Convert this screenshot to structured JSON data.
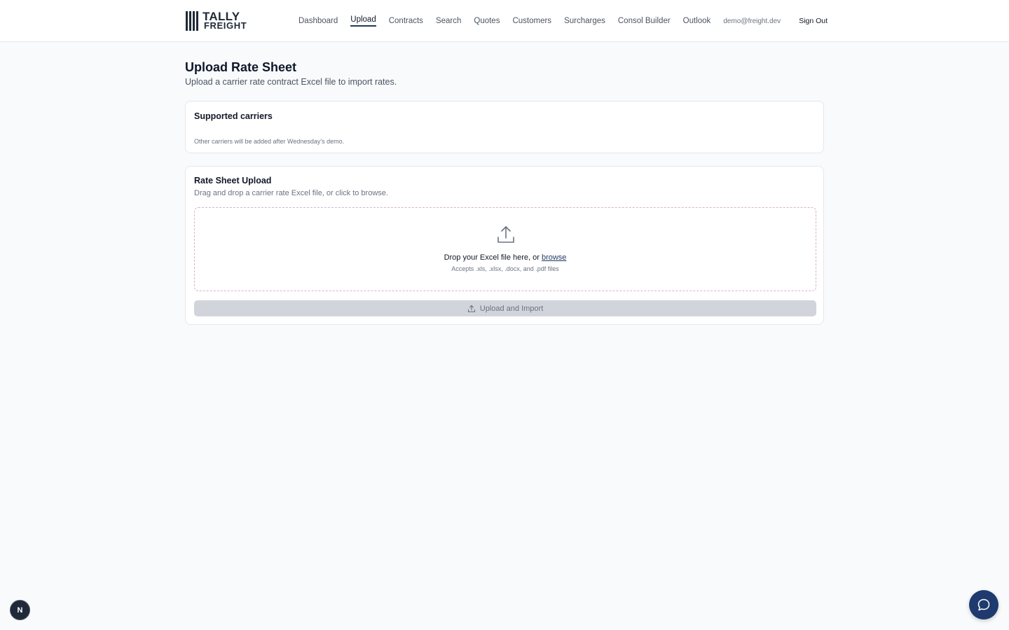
{
  "brand": {
    "line1": "TALLY",
    "line2": "FREIGHT"
  },
  "nav": {
    "items": [
      {
        "label": "Dashboard",
        "active": false
      },
      {
        "label": "Upload",
        "active": true
      },
      {
        "label": "Contracts",
        "active": false
      },
      {
        "label": "Search",
        "active": false
      },
      {
        "label": "Quotes",
        "active": false
      },
      {
        "label": "Customers",
        "active": false
      },
      {
        "label": "Surcharges",
        "active": false
      },
      {
        "label": "Consol Builder",
        "active": false
      },
      {
        "label": "Outlook",
        "active": false
      }
    ],
    "email": "demo@freight.dev",
    "sign_out": "Sign Out"
  },
  "page": {
    "title": "Upload Rate Sheet",
    "subtitle": "Upload a carrier rate contract Excel file to import rates."
  },
  "carriers_card": {
    "title": "Supported carriers",
    "note": "Other carriers will be added after Wednesday's demo."
  },
  "upload_card": {
    "title": "Rate Sheet Upload",
    "description": "Drag and drop a carrier rate Excel file, or click to browse.",
    "drop_text": "Drop your Excel file here, or",
    "browse_label": "browse",
    "accepts": "Accepts .xls, .xlsx, .docx, and .pdf files",
    "button_label": "Upload and Import",
    "button_icon": "upload-icon"
  },
  "badge": {
    "letter": "N"
  },
  "chat": {
    "icon": "chat-bubble-icon"
  },
  "colors": {
    "background": "#f8fafc",
    "accent": "#1f3a5f",
    "chat_button": "#1e3a6e",
    "disabled_button": "#d1d5db"
  }
}
